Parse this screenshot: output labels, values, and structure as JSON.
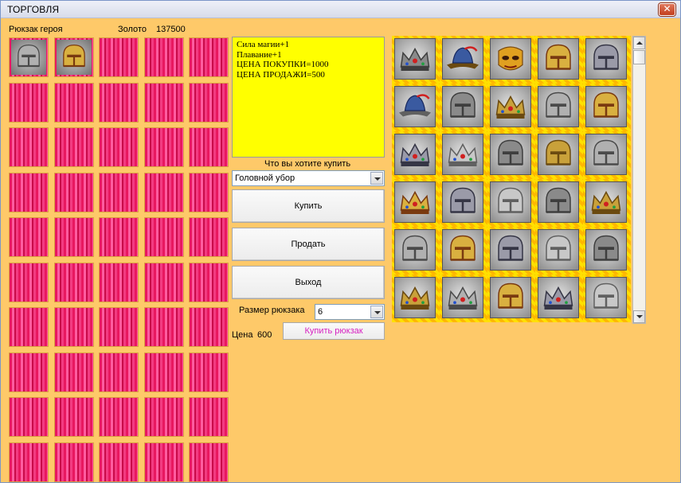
{
  "window": {
    "title": "ТОРГОВЛЯ",
    "close_glyph": "✕"
  },
  "header": {
    "backpack_label": "Рюкзак героя",
    "gold_label": "Золото",
    "gold_value": "137500"
  },
  "info": {
    "lines": [
      "Сила магии+1",
      "Плавание+1",
      "ЦЕНА ПОКУПКИ=1000",
      "ЦЕНА ПРОДАЖИ=500"
    ]
  },
  "buy_section": {
    "prompt": "Что вы хотите купить",
    "category_selected": "Головной убор"
  },
  "buttons": {
    "buy": "Купить",
    "sell": "Продать",
    "exit": "Выход"
  },
  "backpack_size": {
    "label": "Размер рюкзака",
    "selected": "6"
  },
  "backpack_price": {
    "label": "Цена",
    "value": "600",
    "buy_label": "Купить рюкзак"
  },
  "backpack_items": [
    "helmet-icon",
    "helmet-icon"
  ],
  "shop_items": [
    "crown-icon",
    "hat-icon",
    "mask-icon",
    "helmet-icon",
    "helmet-icon",
    "hat-icon",
    "helmet-icon",
    "crown-icon",
    "helmet-icon",
    "helmet-icon",
    "crown-icon",
    "crown-icon",
    "helmet-icon",
    "helmet-icon",
    "helmet-icon",
    "crown-icon",
    "helmet-icon",
    "helmet-icon",
    "helmet-icon",
    "crown-icon",
    "helmet-icon",
    "helmet-icon",
    "helmet-icon",
    "helmet-icon",
    "helmet-icon",
    "crown-icon",
    "crown-icon",
    "helmet-icon",
    "crown-icon",
    "helmet-icon"
  ],
  "colors": {
    "background": "#fec969",
    "info_bg": "#ffff00",
    "slot_pink": "#e8185f",
    "frame_yellow": "#ffe000",
    "buy_backpack_text": "#d61fc0"
  }
}
